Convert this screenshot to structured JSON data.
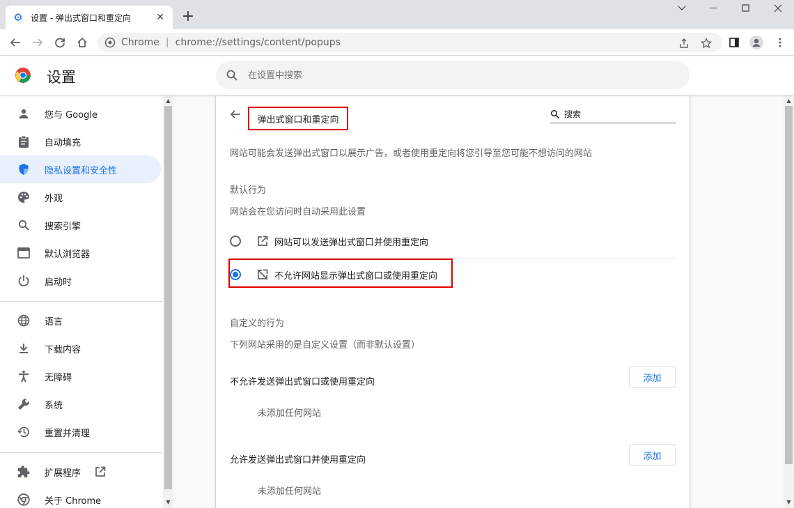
{
  "tab": {
    "title": "设置 - 弹出式窗口和重定向",
    "favicon": "gear-icon"
  },
  "window": {
    "minimize": "minimize-icon",
    "maximize": "maximize-icon",
    "close": "close-icon"
  },
  "toolbar": {
    "site_label": "Chrome",
    "url": "chrome://settings/content/popups"
  },
  "settings": {
    "title": "设置",
    "search_placeholder": "在设置中搜索"
  },
  "sidebar": {
    "items": [
      {
        "label": "您与 Google",
        "icon": "person-icon"
      },
      {
        "label": "自动填充",
        "icon": "clipboard-icon"
      },
      {
        "label": "隐私设置和安全性",
        "icon": "shield-icon",
        "active": true
      },
      {
        "label": "外观",
        "icon": "palette-icon"
      },
      {
        "label": "搜索引擎",
        "icon": "search-icon"
      },
      {
        "label": "默认浏览器",
        "icon": "browser-icon"
      },
      {
        "label": "启动时",
        "icon": "power-icon"
      },
      {
        "label": "语言",
        "icon": "globe-icon"
      },
      {
        "label": "下载内容",
        "icon": "download-icon"
      },
      {
        "label": "无障碍",
        "icon": "accessibility-icon"
      },
      {
        "label": "系统",
        "icon": "wrench-icon"
      },
      {
        "label": "重置并清理",
        "icon": "history-icon"
      },
      {
        "label": "扩展程序",
        "icon": "puzzle-icon"
      },
      {
        "label": "关于 Chrome",
        "icon": "chrome-icon"
      }
    ]
  },
  "page": {
    "title": "弹出式窗口和重定向",
    "search_label": "搜索",
    "description": "网站可能会发送弹出式窗口以展示广告，或者使用重定向将您引导至您可能不想访问的网站",
    "default_heading": "默认行为",
    "default_sub": "网站会在您访问时自动采用此设置",
    "option_allow": "网站可以发送弹出式窗口并使用重定向",
    "option_block": "不允许网站显示弹出式窗口或使用重定向",
    "selected": "block",
    "custom_heading": "自定义的行为",
    "custom_sub": "下列网站采用的是自定义设置（而非默认设置）",
    "block_list_label": "不允许发送弹出式窗口或使用重定向",
    "allow_list_label": "允许发送弹出式窗口并使用重定向",
    "add_label": "添加",
    "empty_label": "未添加任何网站"
  },
  "colors": {
    "accent": "#1a73e8",
    "highlight": "#e00000",
    "active_bg": "#e8f0fe"
  }
}
